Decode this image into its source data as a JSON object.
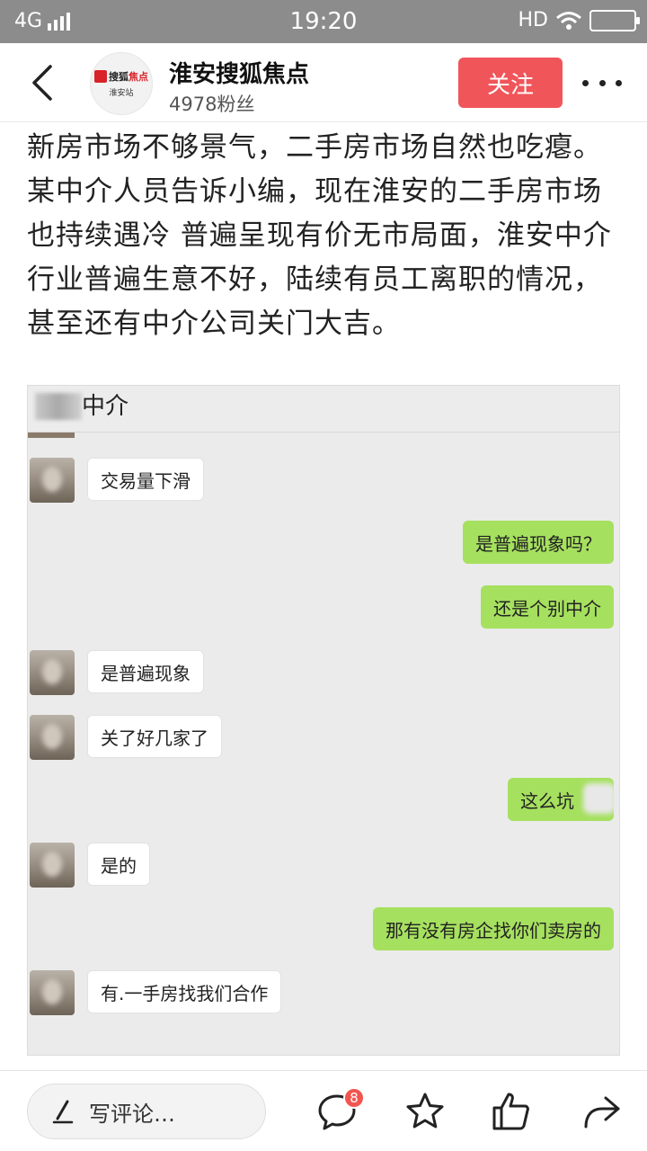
{
  "status_bar": {
    "network": "4G",
    "time": "19:20",
    "hd": "HD"
  },
  "header": {
    "account_name": "淮安搜狐焦点",
    "fans": "4978粉丝",
    "follow_label": "关注",
    "avatar_logo_main": "搜狐",
    "avatar_logo_accent": "焦点",
    "avatar_logo_sub": "淮安站"
  },
  "article": {
    "paragraph": "新房市场不够景气，二手房市场自然也吃瘪。某中介人员告诉小编，现在淮安的二手房市场也持续遇冷 普遍呈现有价无市局面，淮安中介行业普遍生意不好，陆续有员工离职的情况，甚至还有中介公司关门大吉。"
  },
  "chat": {
    "title": "中介",
    "messages": [
      {
        "side": "in",
        "text": "交易量下滑"
      },
      {
        "side": "out",
        "text": "是普遍现象吗？"
      },
      {
        "side": "out",
        "text": "还是个别中介"
      },
      {
        "side": "in",
        "text": "是普遍现象"
      },
      {
        "side": "in",
        "text": "关了好几家了"
      },
      {
        "side": "out",
        "text": "这么坑"
      },
      {
        "side": "in",
        "text": "是的"
      },
      {
        "side": "out",
        "text": "那有没有房企找你们卖房的"
      },
      {
        "side": "in",
        "text": "有.一手房找我们合作"
      }
    ]
  },
  "bottom_bar": {
    "comment_placeholder": "写评论…",
    "comment_count": "8"
  },
  "colors": {
    "follow_button": "#f0555a",
    "out_bubble": "#a6e05f",
    "badge": "#f2554f",
    "status_bar": "#8c8c8c"
  }
}
